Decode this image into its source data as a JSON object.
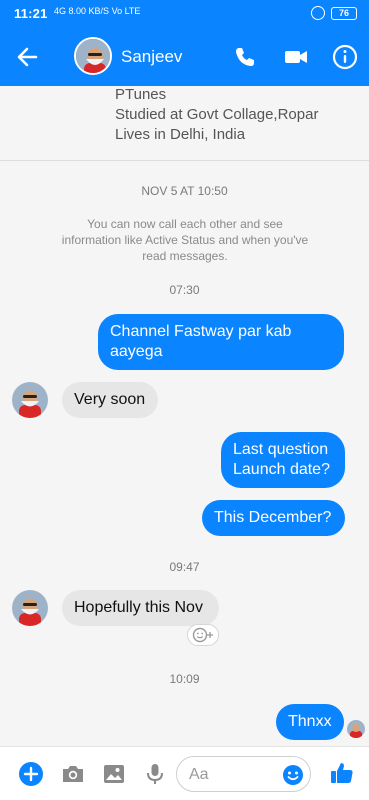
{
  "status": {
    "time": "11:21",
    "network": "4G",
    "speed": "8.00 KB/S",
    "volte": "Vo LTE",
    "battery": "76"
  },
  "header": {
    "title": "Sanjeev"
  },
  "profile": {
    "lines": [
      "PTunes",
      "Studied at Govt Collage,Ropar",
      "Lives in Delhi, India"
    ]
  },
  "chat": {
    "date_label": "NOV 5 AT 10:50",
    "notice": "You can now call each other and see information like Active Status and when you've read messages.",
    "messages": [
      {
        "type": "time",
        "text": "07:30"
      },
      {
        "type": "out",
        "text": "Channel Fastway par kab aayega"
      },
      {
        "type": "in",
        "text": "Very soon"
      },
      {
        "type": "out",
        "text": "Last question Launch date?"
      },
      {
        "type": "out",
        "text": "This December?"
      },
      {
        "type": "time",
        "text": "09:47"
      },
      {
        "type": "in",
        "text": "Hopefully this Nov"
      },
      {
        "type": "time",
        "text": "10:09"
      },
      {
        "type": "out",
        "text": "Thnxx"
      }
    ]
  },
  "composer": {
    "placeholder": "Aa"
  },
  "icons": {
    "back": "back-arrow-icon",
    "call": "phone-icon",
    "video": "video-camera-icon",
    "info": "info-icon",
    "add": "plus-icon",
    "camera": "camera-icon",
    "gallery": "image-icon",
    "mic": "microphone-icon",
    "emoji": "smiley-icon",
    "like": "thumbs-up-icon"
  },
  "colors": {
    "brand": "#0a84ff",
    "outgoing_bubble": "#0a84ff",
    "incoming_bubble": "#e6e6e6"
  }
}
